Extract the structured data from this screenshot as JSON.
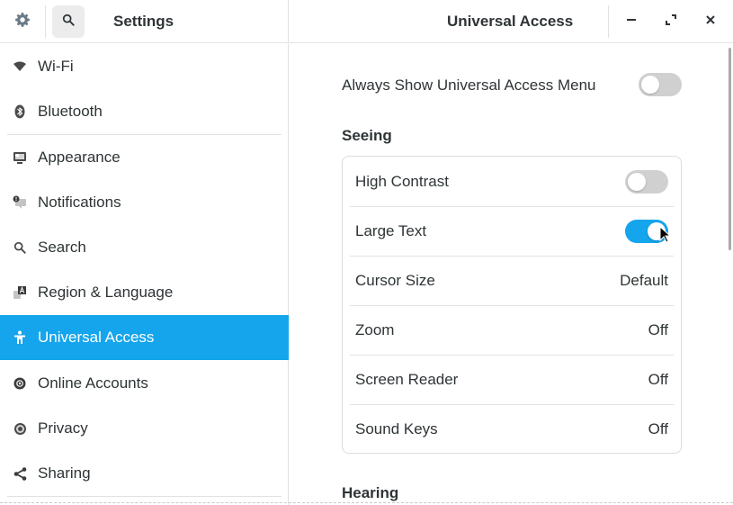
{
  "header": {
    "app_title": "Settings",
    "page_title": "Universal Access",
    "icons": {
      "menu": "gear-icon",
      "search": "search-icon",
      "minimize": "minimize-icon",
      "maximize": "maximize-icon",
      "close": "close-icon"
    }
  },
  "sidebar": {
    "items": [
      {
        "label": "Wi-Fi",
        "icon": "wifi-icon",
        "active": false
      },
      {
        "label": "Bluetooth",
        "icon": "bluetooth-icon",
        "active": false
      },
      {
        "label": "Appearance",
        "icon": "appearance-icon",
        "active": false
      },
      {
        "label": "Notifications",
        "icon": "notifications-icon",
        "active": false
      },
      {
        "label": "Search",
        "icon": "search-icon",
        "active": false
      },
      {
        "label": "Region & Language",
        "icon": "region-language-icon",
        "active": false
      },
      {
        "label": "Universal Access",
        "icon": "universal-access-icon",
        "active": true
      },
      {
        "label": "Online Accounts",
        "icon": "online-accounts-icon",
        "active": false
      },
      {
        "label": "Privacy",
        "icon": "privacy-icon",
        "active": false
      },
      {
        "label": "Sharing",
        "icon": "sharing-icon",
        "active": false
      }
    ]
  },
  "content": {
    "always_show_menu": {
      "label": "Always Show Universal Access Menu",
      "enabled": false
    },
    "seeing": {
      "title": "Seeing",
      "rows": [
        {
          "label": "High Contrast",
          "type": "switch",
          "enabled": false
        },
        {
          "label": "Large Text",
          "type": "switch",
          "enabled": true
        },
        {
          "label": "Cursor Size",
          "type": "value",
          "value": "Default"
        },
        {
          "label": "Zoom",
          "type": "value",
          "value": "Off"
        },
        {
          "label": "Screen Reader",
          "type": "value",
          "value": "Off"
        },
        {
          "label": "Sound Keys",
          "type": "value",
          "value": "Off"
        }
      ]
    },
    "hearing": {
      "title": "Hearing"
    }
  },
  "colors": {
    "accent": "#15a5ec",
    "switch_off": "#d0d0d0",
    "text": "#2e3436"
  }
}
